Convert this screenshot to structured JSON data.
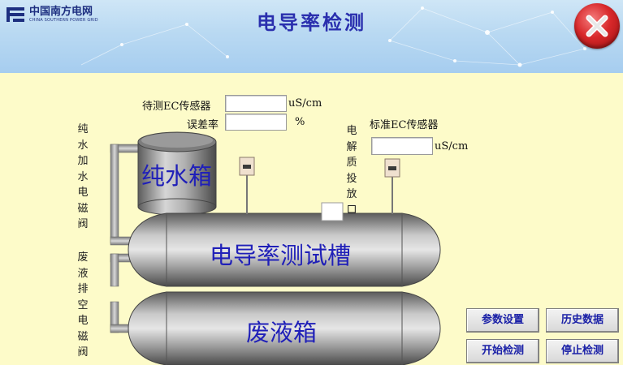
{
  "header": {
    "logo_name": "中国南方电网",
    "logo_sub": "CHINA SOUTHERN POWER GRID",
    "title": "电导率检测",
    "close_icon": "close-x-icon"
  },
  "sensors": {
    "test_label": "待测EC传感器",
    "test_value": "",
    "test_unit": "uS/cm",
    "error_label": "误差率",
    "error_value": "",
    "error_unit": "%",
    "std_label": "标准EC传感器",
    "std_value": "",
    "std_unit": "uS/cm"
  },
  "valves": {
    "pure_water_valve": "纯水加水电磁阀",
    "waste_valve": "废液排空电磁阀",
    "electrolyte_port": "电解质投放口"
  },
  "tanks": {
    "pure_water": "纯水箱",
    "test_tank": "电导率测试槽",
    "waste_tank": "废液箱"
  },
  "buttons": {
    "params": "参数设置",
    "history": "历史数据",
    "start": "开始检测",
    "stop": "停止检测"
  },
  "colors": {
    "background": "#fdfbc9",
    "title": "#2a2fae",
    "tank_label": "#2020b8",
    "close_button": "#d8282a"
  }
}
